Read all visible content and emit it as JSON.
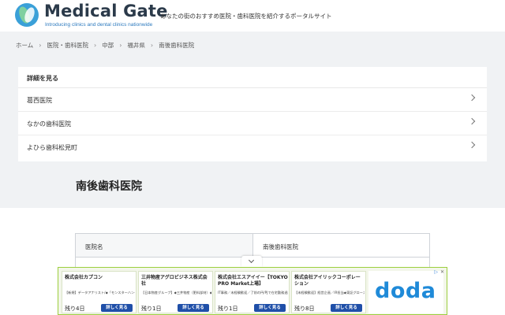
{
  "header": {
    "title": "Medical Gate",
    "subtitle": "Introducing clinics and dental clinics nationwide",
    "tagline": "あなたの街のおすすめ医院・歯科医院を紹介するポータルサイト"
  },
  "breadcrumb": [
    "ホーム",
    "医院・歯科医院",
    "中部",
    "福井県",
    "南後歯科医院"
  ],
  "details_card": {
    "heading": "詳細を見る",
    "items": [
      "葛西医院",
      "なかの歯科医院",
      "よひら歯科松見町"
    ]
  },
  "page_title": "南後歯科医院",
  "info_table": {
    "header_label": "医院名",
    "header_value": "南後歯科医院"
  },
  "ad": {
    "items": [
      {
        "company": "株式会社カプコン",
        "desc": "【新規】データアナリスト/◆「モンスターハンター」等人気タイトル多数／プライ…",
        "remain": "残り4日",
        "button": "詳しく見る"
      },
      {
        "company": "三井物産アグロビジネス株式会社",
        "desc": "【日本物産グループ】◆三井物産（肥料部材）◆日本の農業にイノベーションを/モ…",
        "remain": "残り1日",
        "button": "詳しく見る"
      },
      {
        "company": "株式会社エスアイイー【TOKYO PRO Market上場】",
        "desc": "IT事務／未経験歓迎／了前の円/PJで在宅勤務週み中／土日祝休",
        "remain": "残り1日",
        "button": "詳しく見る"
      },
      {
        "company": "株式会社アイリックコーポレーション",
        "desc": "【未経験歓迎】経営企画／IR担当◆東証グロース・株式対応・M&A推進／上場企業で…",
        "remain": "残り8日",
        "button": "詳しく見る"
      }
    ],
    "brand": "doda"
  }
}
